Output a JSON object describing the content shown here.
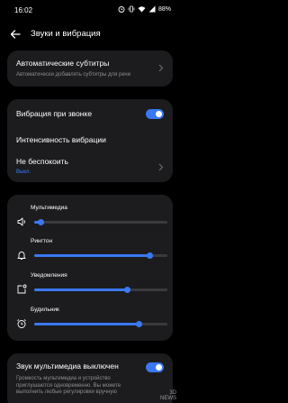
{
  "status": {
    "time": "16:02",
    "battery": "88%"
  },
  "header": {
    "title": "Звуки и вибрация"
  },
  "auto_subtitles": {
    "title": "Автоматические субтитры",
    "subtitle": "Автоматически добавлять субтитры для речи"
  },
  "vibration": {
    "ring_vibration_label": "Вибрация при звонке",
    "ring_vibration_on": true,
    "intensity_label": "Интенсивность вибрации",
    "dnd_label": "Не беспокоить",
    "dnd_status": "Выкл."
  },
  "volume": [
    {
      "label": "Мультимедиа",
      "icon": "speaker-icon",
      "level": 0.05
    },
    {
      "label": "Рингтон",
      "icon": "bell-icon",
      "level": 0.87
    },
    {
      "label": "Уведомления",
      "icon": "notification-icon",
      "level": 0.7
    },
    {
      "label": "Будильник",
      "icon": "alarm-clock-icon",
      "level": 0.79
    }
  ],
  "media_mute": {
    "title": "Звук мультимедиа выключен",
    "description": "Громкость мультимедиа и устройство приглушаются одновременно. Вы можете выполнить любые регулировки вручную",
    "on": true
  },
  "watermark": {
    "line1": "3D",
    "line2": "NEWS"
  },
  "colors": {
    "accent": "#3a78f2",
    "card": "#1c1c1e",
    "background": "#000000"
  }
}
